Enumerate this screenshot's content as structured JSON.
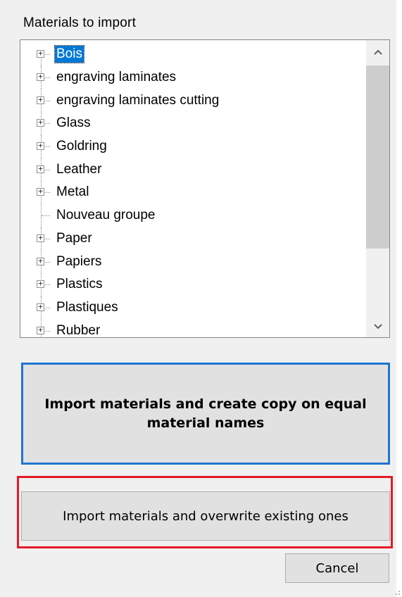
{
  "dialog": {
    "section_label": "Materials to import"
  },
  "tree": {
    "items": [
      {
        "label": "Bois",
        "expandable": true,
        "selected": true
      },
      {
        "label": "engraving laminates",
        "expandable": true,
        "selected": false
      },
      {
        "label": "engraving laminates cutting",
        "expandable": true,
        "selected": false
      },
      {
        "label": "Glass",
        "expandable": true,
        "selected": false
      },
      {
        "label": "Goldring",
        "expandable": true,
        "selected": false
      },
      {
        "label": "Leather",
        "expandable": true,
        "selected": false
      },
      {
        "label": "Metal",
        "expandable": true,
        "selected": false
      },
      {
        "label": "Nouveau groupe",
        "expandable": false,
        "selected": false
      },
      {
        "label": "Paper",
        "expandable": true,
        "selected": false
      },
      {
        "label": "Papiers",
        "expandable": true,
        "selected": false
      },
      {
        "label": "Plastics",
        "expandable": true,
        "selected": false
      },
      {
        "label": "Plastiques",
        "expandable": true,
        "selected": false
      },
      {
        "label": "Rubber",
        "expandable": true,
        "selected": false
      }
    ],
    "expander_glyph": "+"
  },
  "buttons": {
    "copy_label": "Import materials and create copy on equal material names",
    "overwrite_label": "Import materials and overwrite existing ones",
    "cancel_label": "Cancel"
  },
  "colors": {
    "selection": "#0078d7",
    "focus_highlight": "#1f75d0",
    "annotation_red": "#e51a28"
  }
}
